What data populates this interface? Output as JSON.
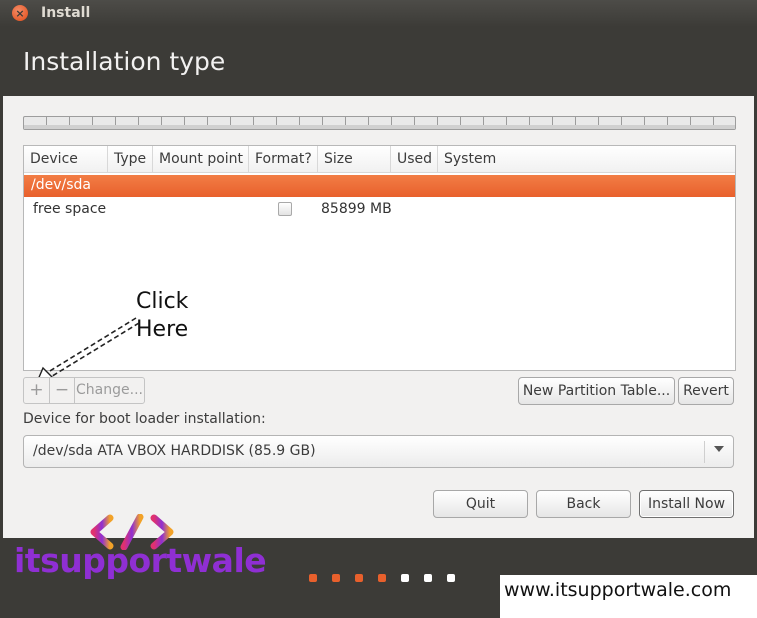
{
  "window": {
    "title": "Install",
    "close_glyph": "×"
  },
  "page_title": "Installation type",
  "table": {
    "headers": [
      "Device",
      "Type",
      "Mount point",
      "Format?",
      "Size",
      "Used",
      "System"
    ],
    "selected_row": {
      "device": "/dev/sda"
    },
    "rows": [
      {
        "device": "free space",
        "format": false,
        "size": "85899 MB"
      }
    ]
  },
  "annotation": {
    "line1": "Click",
    "line2": "Here"
  },
  "toolbar": {
    "add_label": "+",
    "remove_label": "−",
    "change_label": "Change..."
  },
  "buttons": {
    "new_partition_table": "New Partition Table...",
    "revert": "Revert",
    "quit": "Quit",
    "back": "Back",
    "install_now": "Install Now"
  },
  "boot_loader": {
    "label": "Device for boot loader installation:",
    "selected": "/dev/sda  ATA VBOX HARDDISK (85.9 GB)"
  },
  "progress": {
    "total_steps": 7,
    "completed_steps": 4
  },
  "watermark": {
    "brand": "itsupportwale",
    "website": "www.itsupportwale.com"
  },
  "colors": {
    "accent": "#e8602c",
    "dot_done": "#e8602c",
    "dot_todo": "#ffffff",
    "brand_purple": "#8f2fd3"
  },
  "icons": {
    "close": "close-icon",
    "dropdown": "chevron-down-icon",
    "arrow": "annotation-arrow-icon",
    "logo": "code-brackets-logo-icon"
  }
}
